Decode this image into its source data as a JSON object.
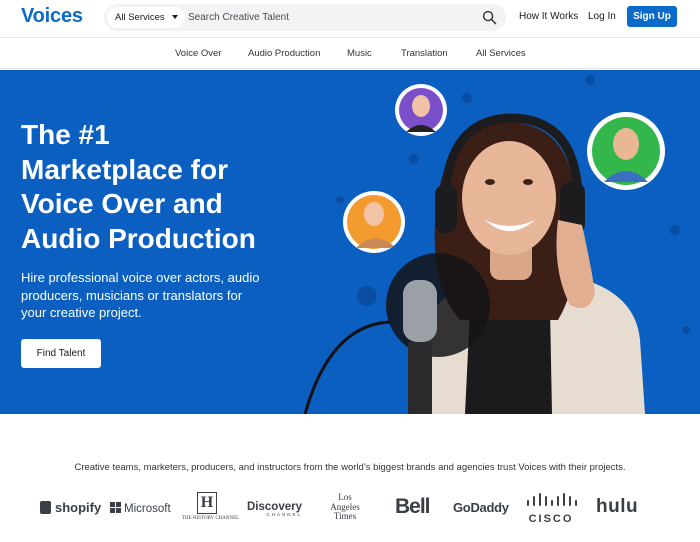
{
  "header": {
    "logo": "Voices",
    "search_category": "All Services",
    "search_placeholder": "Search Creative Talent",
    "how_it_works": "How It Works",
    "login": "Log In",
    "signup": "Sign Up"
  },
  "subnav": {
    "items": [
      "Voice Over",
      "Audio Production",
      "Music",
      "Translation",
      "All Services"
    ]
  },
  "hero": {
    "title_lines": [
      "The #1",
      "Marketplace for",
      "Voice Over and",
      "Audio Production"
    ],
    "subtitle_lines": [
      "Hire professional voice over actors, audio",
      "producers, musicians or translators for",
      "your creative project."
    ],
    "cta": "Find Talent"
  },
  "trust": {
    "text": "Creative teams, marketers, producers, and instructors from the world’s biggest brands and agencies trust Voices with their projects."
  },
  "brands": {
    "shopify": "shopify",
    "microsoft": "Microsoft",
    "history_letter": "H",
    "history_name": "THE HISTORY CHANNEL",
    "discovery": "Discovery",
    "discovery_sub": "CHANNEL",
    "la_times_1": "Los",
    "la_times_2": "Angeles",
    "la_times_3": "Times",
    "bell": "Bell",
    "godaddy": "GoDaddy",
    "cisco": "CISCO",
    "hulu": "hulu"
  },
  "colors": {
    "brand_blue": "#0b6bcb",
    "hero_blue": "#0a5fc1",
    "logo_gray": "#3a3f45"
  }
}
